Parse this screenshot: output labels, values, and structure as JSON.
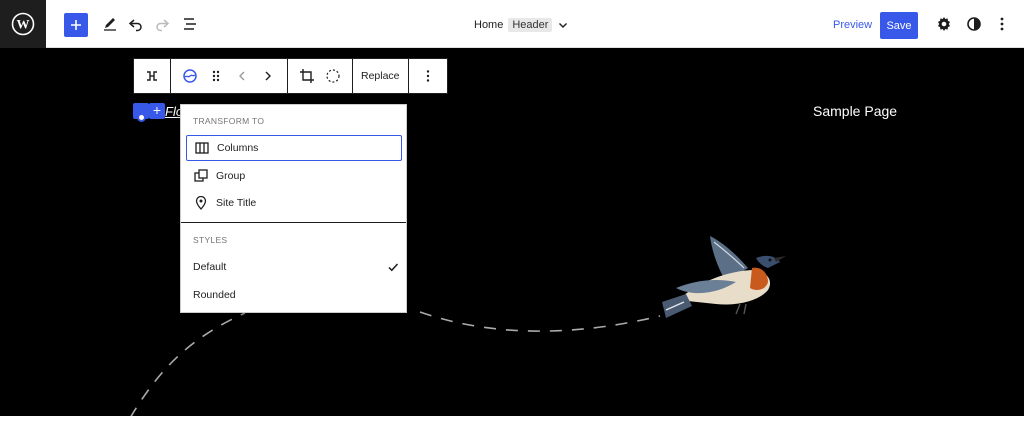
{
  "topbar": {
    "crumb": "Home",
    "tag": "Header",
    "preview_label": "Preview",
    "save_label": "Save"
  },
  "block_toolbar": {
    "replace_label": "Replace"
  },
  "canvas": {
    "site_link": "Flo",
    "sample_page": "Sample Page"
  },
  "dropdown": {
    "transform_heading": "TRANSFORM TO",
    "transform_items": [
      {
        "label": "Columns",
        "icon": "columns-icon"
      },
      {
        "label": "Group",
        "icon": "group-icon"
      },
      {
        "label": "Site Title",
        "icon": "map-pin-icon"
      }
    ],
    "styles_heading": "STYLES",
    "style_items": [
      {
        "label": "Default",
        "selected": true
      },
      {
        "label": "Rounded",
        "selected": false
      }
    ]
  },
  "colors": {
    "accent": "#3858e9",
    "canvas_bg": "#000000",
    "toolbar_dark": "#1e1e1e"
  }
}
